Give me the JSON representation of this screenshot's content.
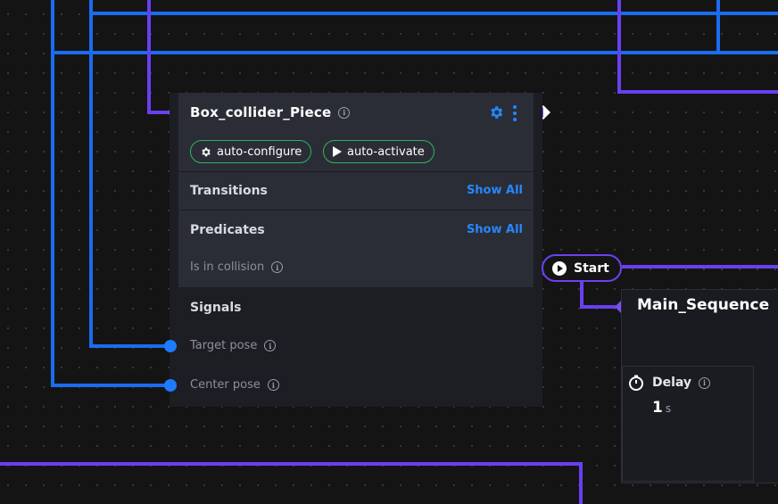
{
  "node": {
    "title": "Box_collider_Piece",
    "tags": [
      {
        "label": "auto-configure",
        "icon": "gear-icon"
      },
      {
        "label": "auto-activate",
        "icon": "play-icon"
      }
    ],
    "transitions": {
      "label": "Transitions",
      "action": "Show All"
    },
    "predicates": {
      "label": "Predicates",
      "action": "Show All",
      "items": [
        "Is in collision"
      ]
    },
    "signals": {
      "label": "Signals",
      "items": [
        "Target pose",
        "Center pose"
      ]
    }
  },
  "start_button": {
    "label": "Start"
  },
  "sequence": {
    "title": "Main_Sequence",
    "delay": {
      "label": "Delay",
      "value": "1",
      "unit": "s"
    }
  },
  "colors": {
    "accent_blue": "#1e7bff",
    "accent_purple": "#6b41f0",
    "tag_border": "#2fb45a"
  }
}
